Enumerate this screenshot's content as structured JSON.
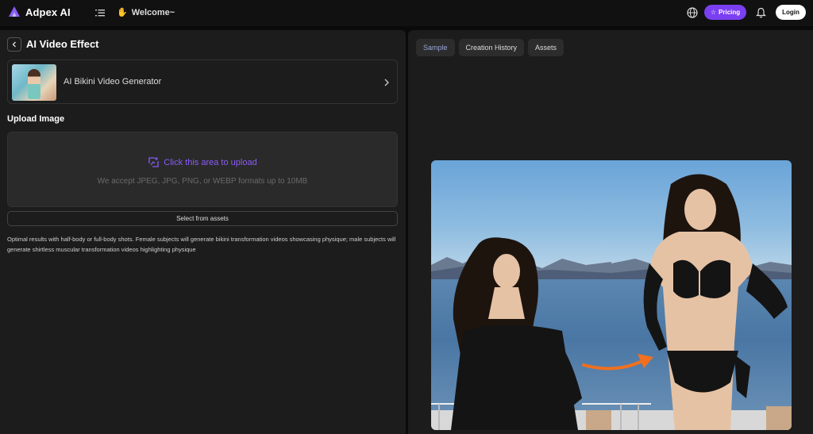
{
  "header": {
    "logo_text": "Adpex AI",
    "welcome_text": "Welcome~",
    "pricing_label": "Pricing",
    "login_label": "Login"
  },
  "left_panel": {
    "title": "AI Video Effect",
    "effect": {
      "name": "AI Bikini Video Generator"
    },
    "upload": {
      "label": "Upload Image",
      "cta": "Click this area to upload",
      "hint": "We accept JPEG, JPG, PNG, or WEBP formats up to 10MB"
    },
    "select_assets_label": "Select from assets",
    "tip": "Optimal results with half-body or full-body shots. Female subjects will generate bikini transformation videos showcasing physique; male subjects will generate shirtless muscular transformation videos highlighting physique"
  },
  "right_panel": {
    "tabs": [
      {
        "label": "Sample",
        "active": true
      },
      {
        "label": "Creation History",
        "active": false
      },
      {
        "label": "Assets",
        "active": false
      }
    ]
  },
  "colors": {
    "accent": "#7b3ff2",
    "upload_text": "#8a5cf6",
    "panel_bg": "#1c1c1c",
    "page_bg": "#0a0a0a"
  },
  "icons": [
    "logo-icon",
    "menu-icon",
    "wave-icon",
    "globe-icon",
    "star-icon",
    "bell-icon",
    "back-icon",
    "chevron-right-icon",
    "upload-icon",
    "arrow-icon"
  ]
}
